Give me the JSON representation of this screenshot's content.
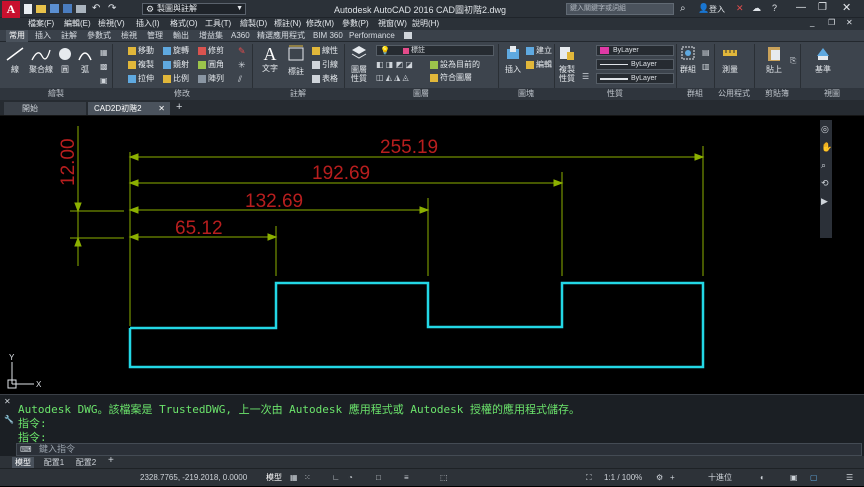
{
  "titlebar": {
    "workspace": "製圖與註解",
    "title": "Autodesk AutoCAD 2016   CAD圖初階2.dwg",
    "search_placeholder": "鍵入關鍵字或詞組",
    "login": "登入"
  },
  "menus": [
    "檔案(F)",
    "編輯(E)",
    "檢視(V)",
    "插入(I)",
    "格式(O)",
    "工具(T)",
    "繪製(D)",
    "標註(N)",
    "修改(M)",
    "參數(P)",
    "視窗(W)",
    "說明(H)"
  ],
  "ribbon_tabs": [
    "常用",
    "插入",
    "註解",
    "參數式",
    "檢視",
    "管理",
    "輸出",
    "增益集",
    "A360",
    "精選應用程式",
    "BIM 360",
    "Performance"
  ],
  "ribbon": {
    "draw": {
      "line": "線",
      "polyline": "聚合線",
      "circle": "圓",
      "arc": "弧"
    },
    "modify": {
      "move": "移動",
      "rotate": "旋轉",
      "trim": "修剪",
      "copy": "複製",
      "mirror": "鏡射",
      "fillet": "圓角",
      "stretch": "拉伸",
      "scale": "比例",
      "array": "陣列"
    },
    "annotation": {
      "text": "文字",
      "dimension": "標註",
      "linear": "線性",
      "leader": "引線",
      "table": "表格"
    },
    "layers": {
      "props": "圖層性質",
      "current_layer": "標註",
      "make_current": "設為目前的",
      "match": "符合圖層"
    },
    "block": {
      "insert": "插入",
      "create": "建立",
      "edit": "編輯"
    },
    "properties": {
      "match": "複製性質",
      "color": "ByLayer",
      "linetype": "ByLayer",
      "lineweight": "ByLayer"
    },
    "group": "群組",
    "utilities": "測量",
    "clipboard": "貼上",
    "base": "基準"
  },
  "ribbon_panels": [
    "繪製",
    "修改",
    "註解",
    "圖層",
    "圖塊",
    "性質",
    "群組",
    "公用程式",
    "剪貼簿",
    "視圖"
  ],
  "doc_tabs": {
    "start": "開始",
    "file": "CAD2D初階2"
  },
  "drawing": {
    "dims": [
      "255.19",
      "192.69",
      "132.69",
      "65.12"
    ],
    "vertical_dim": "12.00",
    "colors": {
      "dim": "#b81e1e",
      "ext": "#8cb000",
      "profile": "#23d7e5"
    }
  },
  "command": {
    "history": [
      "Autodesk DWG。該檔案是 TrustedDWG, 上一次由 Autodesk 應用程式或 Autodesk 授權的應用程式儲存。",
      "指令:",
      "指令:"
    ],
    "placeholder": "鍵入指令"
  },
  "layout_tabs": [
    "模型",
    "配置1",
    "配置2"
  ],
  "status": {
    "coords": "2328.7765, -219.2018, 0.0000",
    "model": "模型",
    "scale": "1:1 / 100%",
    "units": "十進位"
  }
}
